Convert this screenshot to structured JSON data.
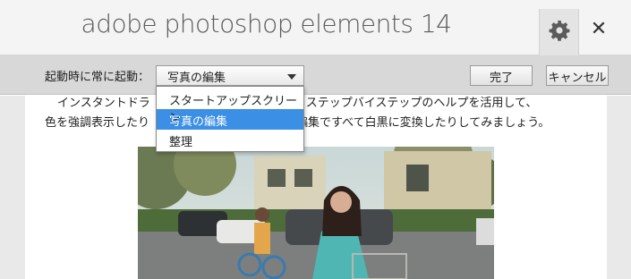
{
  "titlebar": {
    "title": "adobe photoshop elements 14",
    "settings_icon": "gear-icon",
    "close_icon": "close-icon",
    "close_glyph": "✕"
  },
  "settings": {
    "startup_label": "起動時に常に起動：",
    "selected_value": "写真の編集",
    "options": [
      "スタートアップスクリーン",
      "写真の編集",
      "整理"
    ],
    "selected_index": 1,
    "done_label": "完了",
    "cancel_label": "キャンセル"
  },
  "content": {
    "line1": "インスタントドラ",
    "line1_end": "い？ステップバイステップのヘルプを活用して、",
    "line2": "色を強調表示したり",
    "line2_end": "編集ですべて白黒に変換したりしてみましょう。"
  },
  "colors": {
    "selection": "#3b8fe4",
    "settings_bar": "#d8d8d8"
  }
}
